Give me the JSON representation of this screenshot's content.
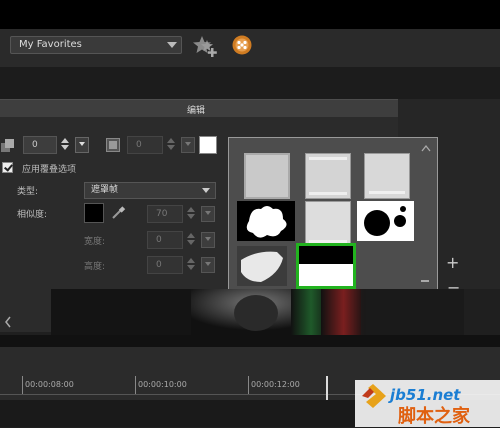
{
  "library": {
    "favorites_label": "My Favorites"
  },
  "tab": {
    "label": "编辑"
  },
  "controls": {
    "row1_value1": "0",
    "row1_value2": "0",
    "apply_overlay_label": "应用覆叠选项",
    "type_label": "类型:",
    "type_value": "遮罩帧",
    "similarity_label": "相似度:",
    "similarity_value": "70",
    "width_label": "宽度:",
    "width_value": "0",
    "height_label": "高度:",
    "height_value": "0"
  },
  "side": {
    "plus": "+",
    "minus": "−"
  },
  "timeline": {
    "ticks": [
      "00:00:08:00",
      "00:00:10:00",
      "00:00:12:00"
    ]
  },
  "watermark": {
    "site": "jb51.net",
    "name": "脚本之家"
  },
  "colors": {
    "selection": "#22b31f",
    "accent_orange": "#d07c22"
  },
  "icons": [
    "star-add-icon",
    "painter-icon",
    "shadow-icon",
    "color-picker-icon",
    "eyedropper-icon",
    "scroll-up-icon",
    "scroll-down-icon",
    "left-arrow-icon"
  ]
}
